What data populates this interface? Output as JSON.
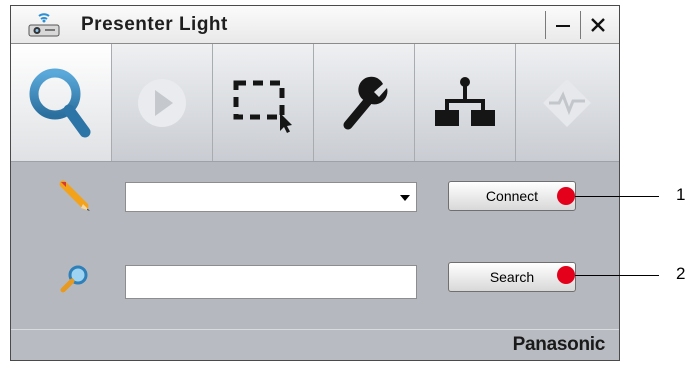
{
  "window": {
    "title": "Presenter Light",
    "minimize_symbol": "−",
    "close_symbol": "✕",
    "app_icon": "projector-wifi-icon"
  },
  "toolbar": {
    "tools": [
      {
        "icon": "search-icon"
      },
      {
        "icon": "play-icon"
      },
      {
        "icon": "region-select-icon"
      },
      {
        "icon": "wrench-icon"
      },
      {
        "icon": "network-icon"
      },
      {
        "icon": "signal-diamond-icon"
      }
    ]
  },
  "connect_row": {
    "icon": "pencil-icon",
    "combo_value": "",
    "button_label": "Connect"
  },
  "search_row": {
    "icon": "magnifier-icon",
    "input_value": "",
    "input_placeholder": "",
    "button_label": "Search"
  },
  "footer": {
    "brand": "Panasonic"
  },
  "callouts": [
    {
      "number": "1"
    },
    {
      "number": "2"
    }
  ],
  "colors": {
    "accent_search": "#3a87b8",
    "callout": "#e4001a",
    "toolbar_icon": "#1a1a1a",
    "disabled_icon": "#e7e9ec"
  }
}
